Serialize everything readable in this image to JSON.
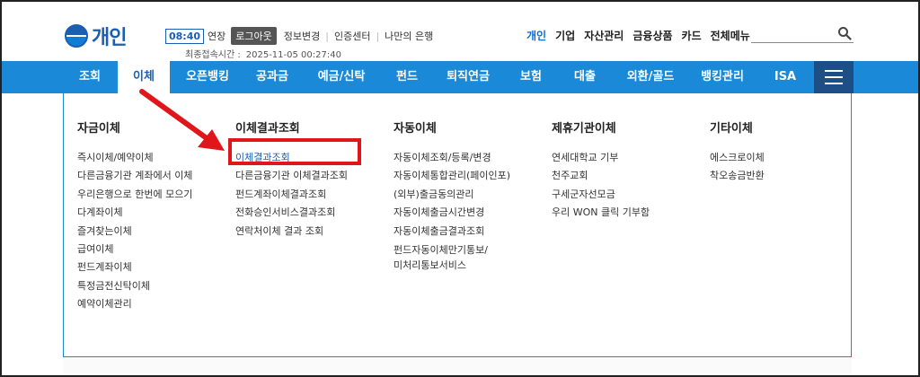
{
  "header": {
    "logo_text": "개인",
    "timer": "08:40",
    "extend_label": "연장",
    "logout_label": "로그아웃",
    "util_links": [
      "정보변경",
      "인증센터",
      "나만의 은행"
    ],
    "last_login_label": "최종접속시간 :",
    "last_login_value": "2025-11-05 00:27:40",
    "top_nav": [
      "개인",
      "기업",
      "자산관리",
      "금융상품",
      "카드",
      "전체메뉴"
    ],
    "search_icon": "search-icon"
  },
  "gnb": {
    "items": [
      "조회",
      "이체",
      "오픈뱅킹",
      "공과금",
      "예금/신탁",
      "펀드",
      "퇴직연금",
      "보험",
      "대출",
      "외환/골드",
      "뱅킹관리",
      "ISA"
    ],
    "menu_icon": "hamburger-icon"
  },
  "dropdown": {
    "columns": [
      {
        "title": "자금이체",
        "items": [
          "즉시이체/예약이체",
          "다른금융기관 계좌에서 이체",
          "우리은행으로 한번에 모으기",
          "다계좌이체",
          "즐겨찾는이체",
          "급여이체",
          "펀드계좌이체",
          "특정금전신탁이체",
          "예약이체관리"
        ]
      },
      {
        "title": "이체결과조회",
        "items": [
          "이체결과조회",
          "다른금융기관 이체결과조회",
          "펀드계좌이체결과조회",
          "전화승인서비스결과조회",
          "연락처이체 결과 조회"
        ]
      },
      {
        "title": "자동이체",
        "items": [
          "자동이체조회/등록/변경",
          "자동이체통합관리(페이인포)",
          "(외부)출금동의관리",
          "자동이체출금시간변경",
          "자동이체출금결과조회",
          "펀드자동이체만기통보/",
          "미처리통보서비스"
        ]
      },
      {
        "title": "제휴기관이체",
        "items": [
          "연세대학교 기부",
          "천주교회",
          "구세군자선모금",
          "우리 WON 클릭 기부함"
        ]
      },
      {
        "title": "기타이체",
        "items": [
          "에스크로이체",
          "착오송금반환"
        ]
      }
    ]
  },
  "colors": {
    "brand_blue": "#1a8ad8",
    "dark_blue": "#1d4f86",
    "highlight_red": "#e0161b"
  }
}
